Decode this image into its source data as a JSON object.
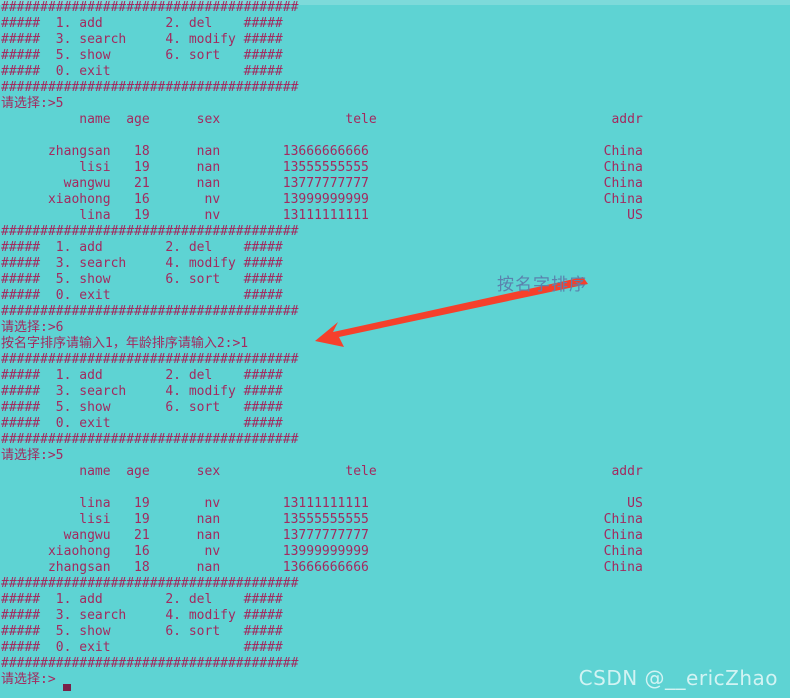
{
  "terminal": {
    "background_color": "#5ed3d3",
    "text_color": "#a32a5f",
    "lines": [
      "######################################",
      "#####  1. add        2. del    #####",
      "#####  3. search     4. modify #####",
      "#####  5. show       6. sort   #####",
      "#####  0. exit                 #####",
      "######################################",
      "请选择:>5",
      "          name  age      sex                tele                              addr",
      "",
      "      zhangsan   18      nan        13666666666                              China",
      "          lisi   19      nan        13555555555                              China",
      "        wangwu   21      nan        13777777777                              China",
      "      xiaohong   16       nv        13999999999                              China",
      "          lina   19       nv        13111111111                                 US",
      "######################################",
      "#####  1. add        2. del    #####",
      "#####  3. search     4. modify #####",
      "#####  5. show       6. sort   #####",
      "#####  0. exit                 #####",
      "######################################",
      "请选择:>6",
      "按名字排序请输入1，年龄排序请输入2:>1",
      "######################################",
      "#####  1. add        2. del    #####",
      "#####  3. search     4. modify #####",
      "#####  5. show       6. sort   #####",
      "#####  0. exit                 #####",
      "######################################",
      "请选择:>5",
      "          name  age      sex                tele                              addr",
      "",
      "          lina   19       nv        13111111111                                 US",
      "          lisi   19      nan        13555555555                              China",
      "        wangwu   21      nan        13777777777                              China",
      "      xiaohong   16       nv        13999999999                              China",
      "      zhangsan   18      nan        13666666666                              China",
      "######################################",
      "#####  1. add        2. del    #####",
      "#####  3. search     4. modify #####",
      "#####  5. show       6. sort   #####",
      "#####  0. exit                 #####",
      "######################################",
      "请选择:>"
    ]
  },
  "menu": {
    "items": [
      {
        "number": "1.",
        "label": "add"
      },
      {
        "number": "2.",
        "label": "del"
      },
      {
        "number": "3.",
        "label": "search"
      },
      {
        "number": "4.",
        "label": "modify"
      },
      {
        "number": "5.",
        "label": "show"
      },
      {
        "number": "6.",
        "label": "sort"
      },
      {
        "number": "0.",
        "label": "exit"
      }
    ],
    "border_char": "#",
    "side_marker": "#####",
    "prompt": "请选择:>"
  },
  "prompts": {
    "choice_5_first": "请选择:>5",
    "choice_6": "请选择:>6",
    "sort_question": "按名字排序请输入1，年龄排序请输入2:>1",
    "choice_5_second": "请选择:>5",
    "choice_empty": "请选择:>"
  },
  "table": {
    "columns": [
      "name",
      "age",
      "sex",
      "tele",
      "addr"
    ],
    "unsorted_rows": [
      {
        "name": "zhangsan",
        "age": "18",
        "sex": "nan",
        "tele": "13666666666",
        "addr": "China"
      },
      {
        "name": "lisi",
        "age": "19",
        "sex": "nan",
        "tele": "13555555555",
        "addr": "China"
      },
      {
        "name": "wangwu",
        "age": "21",
        "sex": "nan",
        "tele": "13777777777",
        "addr": "China"
      },
      {
        "name": "xiaohong",
        "age": "16",
        "sex": "nv",
        "tele": "13999999999",
        "addr": "China"
      },
      {
        "name": "lina",
        "age": "19",
        "sex": "nv",
        "tele": "13111111111",
        "addr": "US"
      }
    ],
    "sorted_rows": [
      {
        "name": "lina",
        "age": "19",
        "sex": "nv",
        "tele": "13111111111",
        "addr": "US"
      },
      {
        "name": "lisi",
        "age": "19",
        "sex": "nan",
        "tele": "13555555555",
        "addr": "China"
      },
      {
        "name": "wangwu",
        "age": "21",
        "sex": "nan",
        "tele": "13777777777",
        "addr": "China"
      },
      {
        "name": "xiaohong",
        "age": "16",
        "sex": "nv",
        "tele": "13999999999",
        "addr": "China"
      },
      {
        "name": "zhangsan",
        "age": "18",
        "sex": "nan",
        "tele": "13666666666",
        "addr": "China"
      }
    ]
  },
  "annotation": {
    "label": "按名字排序",
    "label_color": "#5b82ad",
    "arrow_color": "#f5402c"
  },
  "watermark": {
    "text": "CSDN @__ericZhao",
    "color": "#ffffff"
  }
}
